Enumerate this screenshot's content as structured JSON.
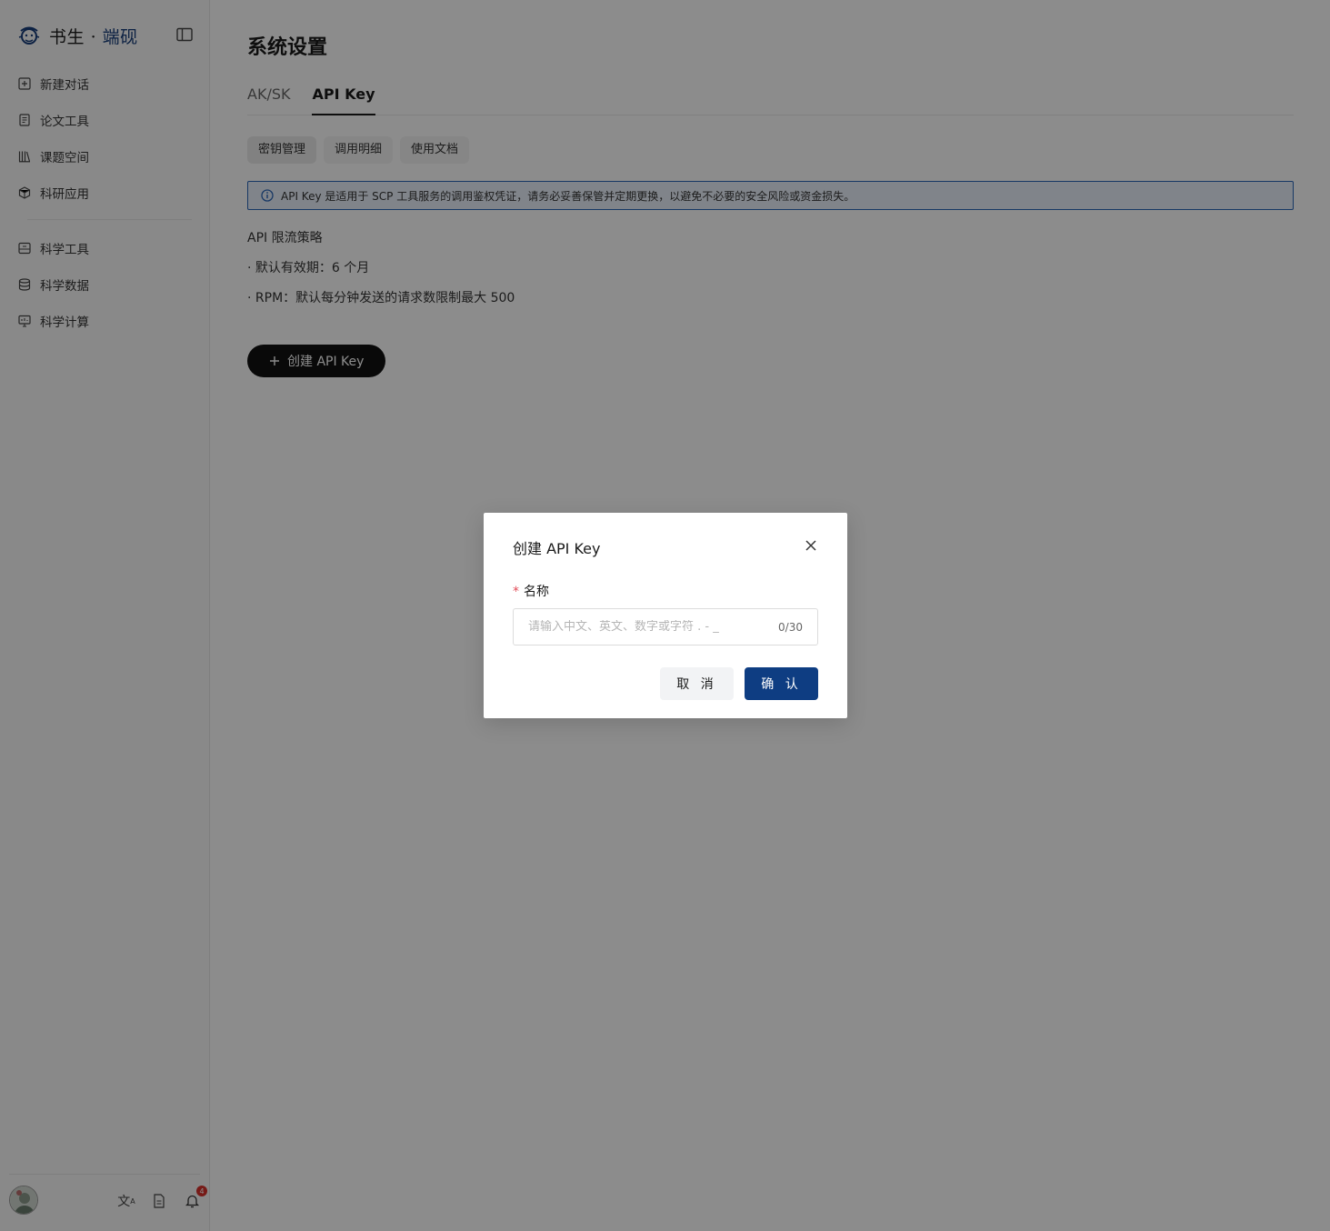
{
  "brand": {
    "name_main": "书生",
    "dot": "·",
    "name_accent": "端砚"
  },
  "sidebar": {
    "items_top": [
      {
        "label": "新建对话",
        "icon": "plus-square-icon"
      },
      {
        "label": "论文工具",
        "icon": "document-icon"
      },
      {
        "label": "课题空间",
        "icon": "library-icon"
      },
      {
        "label": "科研应用",
        "icon": "cube-icon"
      }
    ],
    "items_bottom": [
      {
        "label": "科学工具",
        "icon": "toolbox-icon"
      },
      {
        "label": "科学数据",
        "icon": "database-icon"
      },
      {
        "label": "科学计算",
        "icon": "monitor-icon"
      }
    ],
    "footer": {
      "notification_count": "4",
      "translate_glyph": "文",
      "translate_sup": "A"
    }
  },
  "page": {
    "title": "系统设置",
    "tabs": [
      "AK/SK",
      "API Key"
    ],
    "active_tab": "API Key",
    "subtabs": [
      "密钥管理",
      "调用明细",
      "使用文档"
    ],
    "alert": "API Key 是适用于 SCP 工具服务的调用鉴权凭证，请务必妥善保管并定期更换，以避免不必要的安全风险或资金损失。",
    "policy": {
      "heading": "API 限流策略",
      "lines": [
        "· 默认有效期：6 个月",
        "· RPM：默认每分钟发送的请求数限制最大 500"
      ]
    },
    "create_button": "创建 API Key"
  },
  "modal": {
    "title": "创建 API Key",
    "field_label": "名称",
    "required_mark": "*",
    "placeholder": "请输入中文、英文、数字或字符 . - _",
    "value": "",
    "counter": "0/30",
    "cancel": "取 消",
    "confirm": "确 认"
  },
  "colors": {
    "accent": "#0e3d82",
    "alert_border": "#2a66b8",
    "badge": "#d7302a",
    "required": "#e34d59"
  }
}
